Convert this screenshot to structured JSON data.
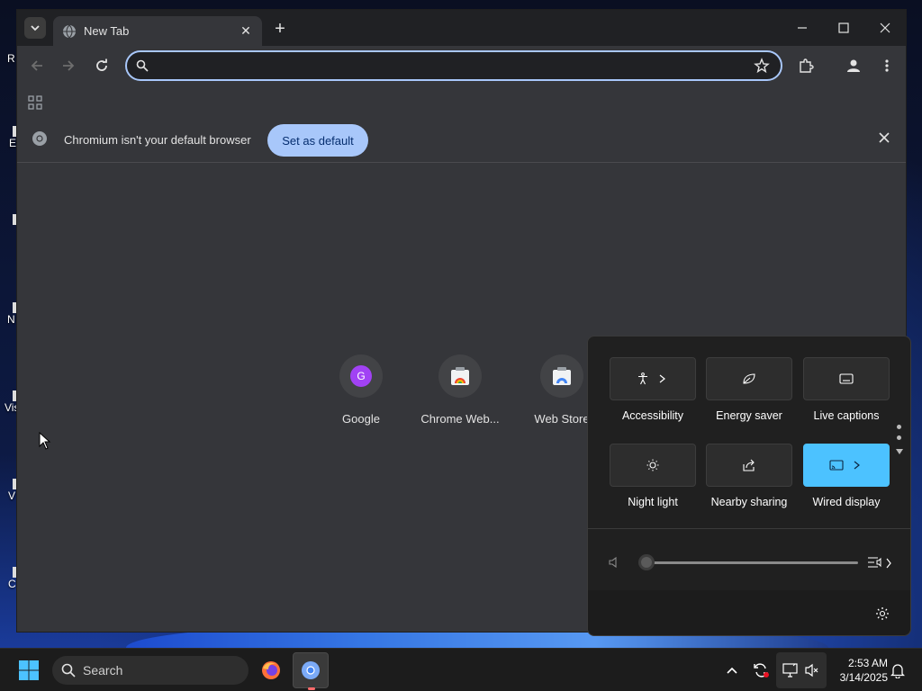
{
  "desktop": {
    "icon_labels": [
      "R",
      "E",
      "N",
      "Vis",
      "V",
      "C"
    ]
  },
  "browser": {
    "tab": {
      "title": "New Tab"
    },
    "omnibox": {
      "value": "",
      "placeholder": ""
    },
    "infobar": {
      "message": "Chromium isn't your default browser",
      "button_label": "Set as default"
    },
    "shortcuts": [
      {
        "label": "Google",
        "letter": "G"
      },
      {
        "label": "Chrome Web..."
      },
      {
        "label": "Web Store"
      }
    ]
  },
  "quick_settings": {
    "tiles": [
      {
        "label": "Accessibility",
        "active": false
      },
      {
        "label": "Energy saver",
        "active": false
      },
      {
        "label": "Live captions",
        "active": false
      },
      {
        "label": "Night light",
        "active": false
      },
      {
        "label": "Nearby sharing",
        "active": false
      },
      {
        "label": "Wired display",
        "active": true
      }
    ],
    "volume_level": 0,
    "accent_color": "#4cc2ff"
  },
  "taskbar": {
    "search_label": "Search",
    "time": "2:53 AM",
    "date": "3/14/2025"
  },
  "colors": {
    "omnibox_border": "#a8c7fa",
    "set_default_bg": "#a8c7fa",
    "google_badge": "#a142f4"
  }
}
